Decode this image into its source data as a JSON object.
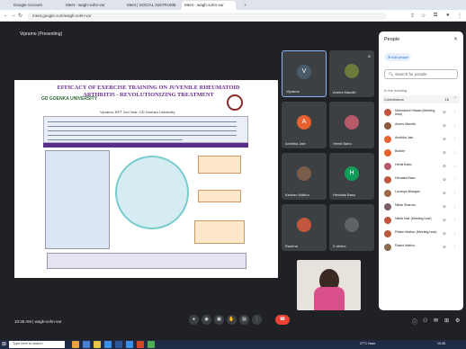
{
  "browser": {
    "tabs": [
      "Google Account",
      "Meet - wagh-xohn-vur",
      "Meet | SOCIAL INSTRUMENTS",
      "Meet - wagh-xohn-vur"
    ],
    "new_tab": "+",
    "url": "meet.google.com/wagh-xohn-vur"
  },
  "meet": {
    "presenting_label": "Vipramo (Presenting)",
    "meeting_code": "10:35 AM | wagh-xohn-vur"
  },
  "slide": {
    "title": "EFFICACY OF EXERCISE TRAINING ON JUVENILE RHEUMATOID ARTHRITIS - REVOLUTIONIZING TREATMENT",
    "logo_text": "GD GOENKA UNIVERSITY",
    "authors": "Vipramo, BPT 2nd Year, GD Goenka University"
  },
  "tiles": [
    {
      "name": "Vipramo",
      "initial": "V",
      "color": "#4a5c6a"
    },
    {
      "name": "Anees Maudib",
      "initial": "",
      "color": "#6d7a3c"
    },
    {
      "name": "Anshika Jain",
      "initial": "A",
      "color": "#e8622f"
    },
    {
      "name": "Hemil Babu",
      "initial": "",
      "color": "#b55a6a"
    },
    {
      "name": "Keshav Mathur",
      "initial": "",
      "color": "#7a5c4a"
    },
    {
      "name": "Hemlata Basu",
      "initial": "H",
      "color": "#0f9d58"
    },
    {
      "name": "Rachna",
      "initial": "",
      "color": "#c2553d"
    },
    {
      "name": "2 others",
      "initial": "",
      "color": "#5f6368"
    }
  ],
  "people": {
    "title": "People",
    "add_label": "Add people",
    "search_placeholder": "Search for people",
    "section": "In the meeting",
    "contributors": "Contributors",
    "count": "16",
    "list": [
      {
        "name": "Meenakshi Hitaasi (Meeting host)",
        "color": "#c2553d"
      },
      {
        "name": "Anees Maudib",
        "color": "#8a5a3c"
      },
      {
        "name": "Anshika Jain",
        "color": "#e8622f"
      },
      {
        "name": "Bobbie",
        "color": "#e8622f"
      },
      {
        "name": "Hemil Babu",
        "color": "#b55a6a"
      },
      {
        "name": "Hemlata Basu",
        "color": "#c2553d"
      },
      {
        "name": "Lavanya Bhargav",
        "color": "#9c6a4a"
      },
      {
        "name": "Nikita Sharma",
        "color": "#7a5c6a"
      },
      {
        "name": "Nikita Nair (Meeting host)",
        "color": "#c2553d"
      },
      {
        "name": "Pritam Mathur (Meeting host)",
        "color": "#b55a3c"
      },
      {
        "name": "Rasmi Mathur",
        "color": "#8a6a4a"
      }
    ]
  },
  "taskbar": {
    "search": "Type here to search",
    "weather": "27°C Haze",
    "time": "10:35",
    "date": "24-10-2023"
  }
}
